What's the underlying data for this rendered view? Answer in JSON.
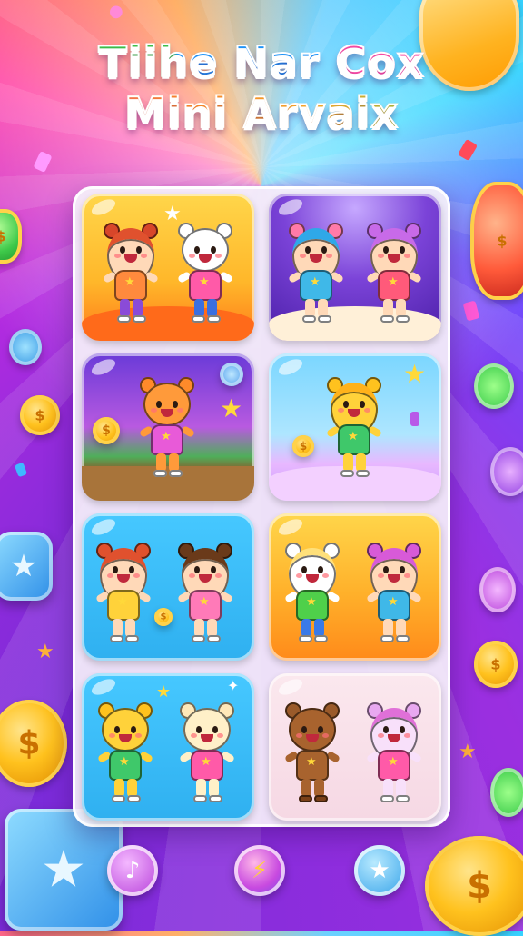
{
  "title": {
    "line1": "Tiihe Nar Cox",
    "line2": "Mini Arvaix"
  },
  "colors": {
    "title_green": "#3ec94a",
    "title_blue": "#1e9bff",
    "title_pink": "#ff4fa8",
    "title_orange": "#ff8a2a",
    "board_bg": "#f5f0fa",
    "coin_gold": "#ffc21e"
  },
  "cards": [
    {
      "theme": "sunny-orange",
      "characters": [
        "girl-redhair-icon",
        "bear-white-icon"
      ]
    },
    {
      "theme": "purple-stage",
      "characters": [
        "girl-bluehair-icon",
        "girl-pinkhair-icon"
      ]
    },
    {
      "theme": "disco-stage",
      "characters": [
        "bear-orange-icon"
      ]
    },
    {
      "theme": "sky-clouds",
      "characters": [
        "bear-yellow-icon"
      ]
    },
    {
      "theme": "aqua",
      "characters": [
        "girl-redhair-icon",
        "girl-brownhair-icon"
      ]
    },
    {
      "theme": "orange-glow",
      "characters": [
        "bear-white-icon",
        "girl-pinkhair-icon"
      ]
    },
    {
      "theme": "aqua-light",
      "characters": [
        "bear-yellow-icon",
        "bear-cream-icon"
      ]
    },
    {
      "theme": "pale-pink",
      "characters": [
        "bear-brown-icon",
        "bear-pink-icon"
      ]
    }
  ],
  "bottom_buttons": [
    "music-icon",
    "magic-wand-icon",
    "star-icon"
  ]
}
